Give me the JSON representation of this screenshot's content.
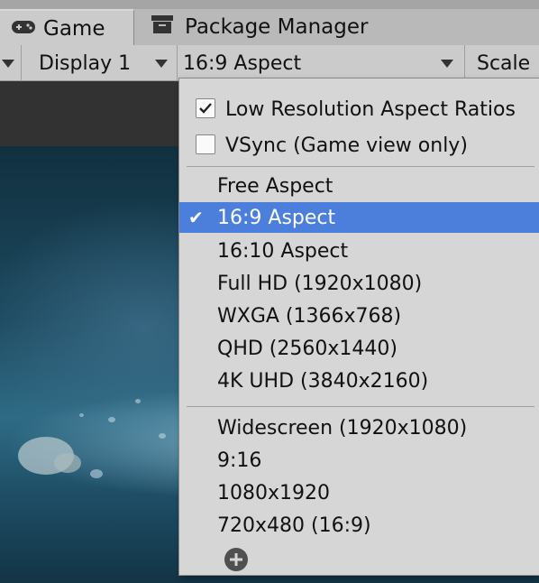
{
  "tabs": [
    {
      "label": "Game",
      "icon": "gamepad-icon"
    },
    {
      "label": "Package Manager",
      "icon": "package-icon"
    }
  ],
  "toolbar": {
    "display": "Display 1",
    "aspect": "16:9 Aspect",
    "scale": "Scale"
  },
  "dropdown": {
    "toggles": [
      {
        "label": "Low Resolution Aspect Ratios",
        "checked": true
      },
      {
        "label": "VSync (Game view only)",
        "checked": false
      }
    ],
    "group1": [
      {
        "label": "Free Aspect",
        "selected": false
      },
      {
        "label": "16:9 Aspect",
        "selected": true
      },
      {
        "label": "16:10 Aspect",
        "selected": false
      },
      {
        "label": "Full HD (1920x1080)",
        "selected": false
      },
      {
        "label": "WXGA (1366x768)",
        "selected": false
      },
      {
        "label": "QHD (2560x1440)",
        "selected": false
      },
      {
        "label": "4K UHD (3840x2160)",
        "selected": false
      }
    ],
    "group2": [
      {
        "label": "Widescreen (1920x1080)"
      },
      {
        "label": "9:16"
      },
      {
        "label": "1080x1920"
      },
      {
        "label": "720x480 (16:9)"
      }
    ]
  },
  "colors": {
    "selection": "#4b7fdb"
  }
}
